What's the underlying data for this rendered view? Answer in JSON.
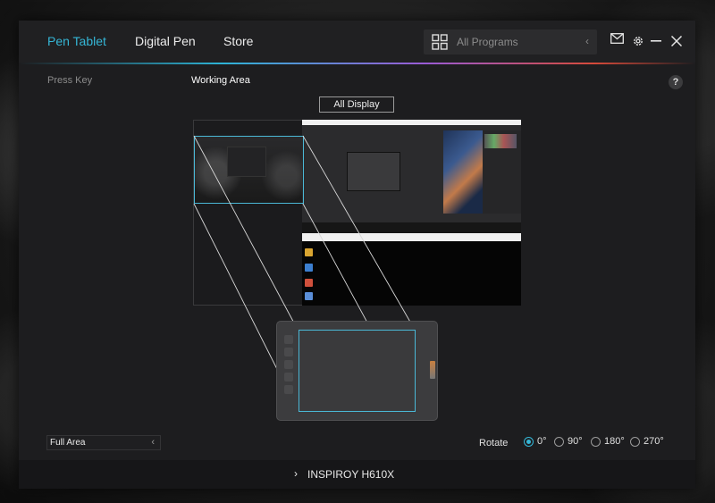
{
  "tabs": [
    {
      "label": "Pen Tablet",
      "active": true
    },
    {
      "label": "Digital Pen",
      "active": false
    },
    {
      "label": "Store",
      "active": false
    }
  ],
  "program_select": {
    "label": "All Programs",
    "icon": "grid-icon"
  },
  "window_controls": [
    "mail-icon",
    "gear-icon",
    "minimize-icon",
    "close-icon"
  ],
  "sections": {
    "press_key": "Press Key",
    "working_area": "Working Area"
  },
  "help_label": "?",
  "display_button": "All Display",
  "area_select": {
    "value": "Full Area"
  },
  "rotate": {
    "label": "Rotate",
    "options": [
      {
        "label": "0°",
        "checked": true
      },
      {
        "label": "90°",
        "checked": false
      },
      {
        "label": "180°",
        "checked": false
      },
      {
        "label": "270°",
        "checked": false
      }
    ]
  },
  "device": {
    "name": "INSPIROY H610X"
  },
  "colors": {
    "accent": "#35b6d6",
    "window_bg": "#1d1d1f",
    "bottombar_bg": "#161618"
  }
}
